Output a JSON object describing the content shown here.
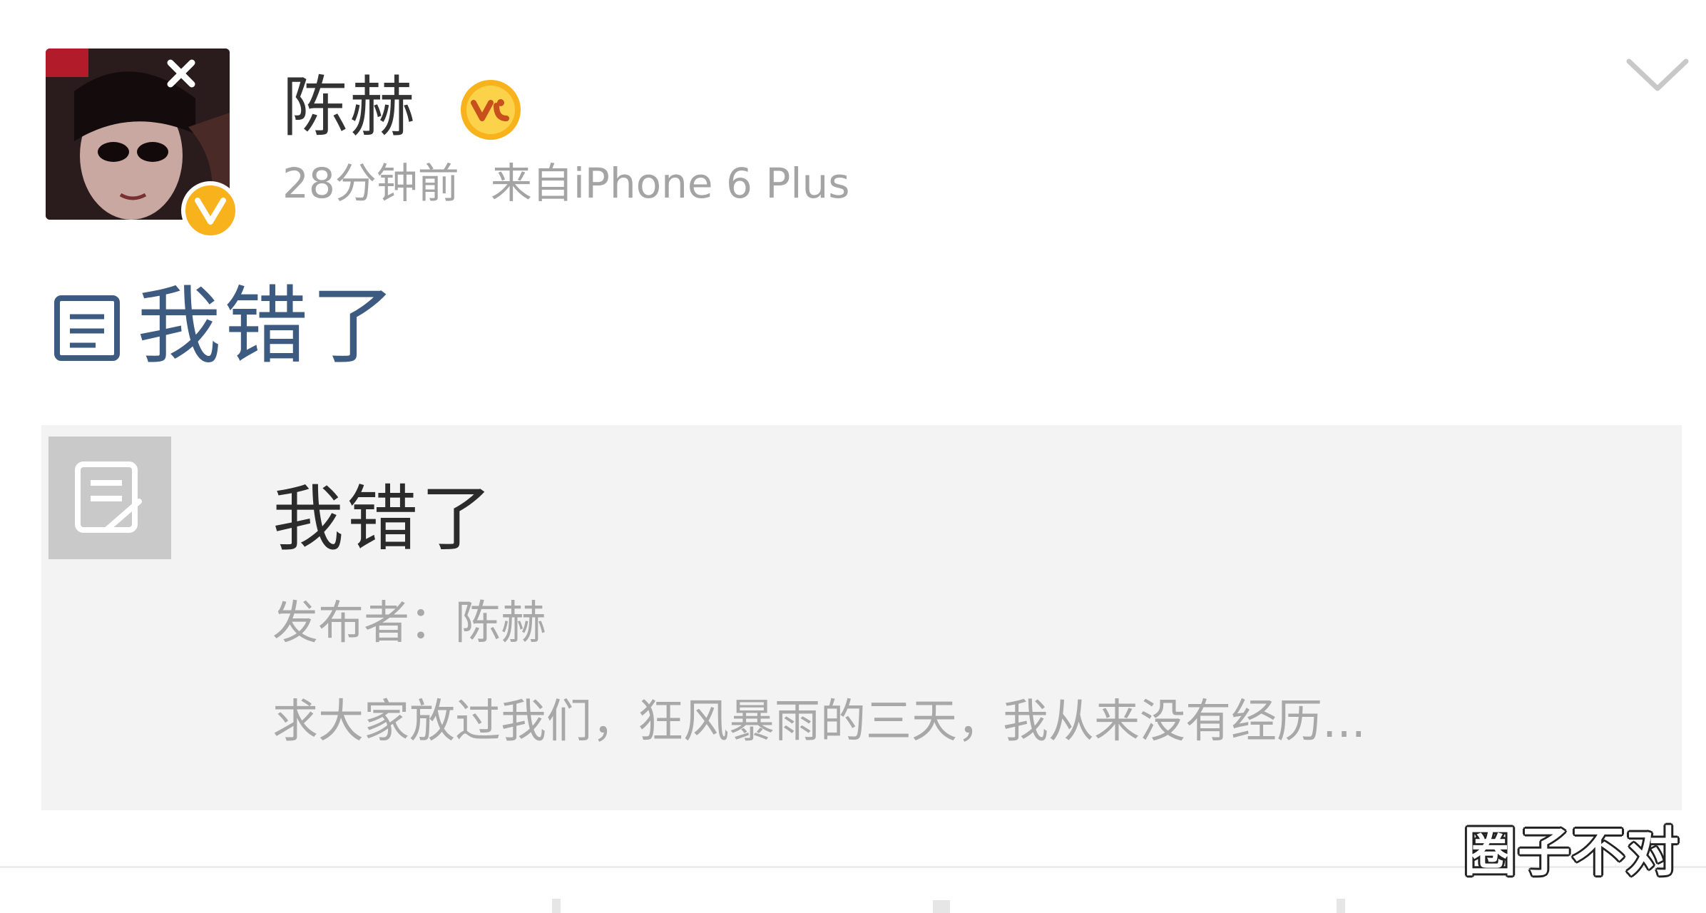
{
  "post": {
    "username": "陈赫",
    "time": "28分钟前",
    "source": "来自iPhone 6 Plus",
    "text": "我错了"
  },
  "card": {
    "title": "我错了",
    "author": "发布者：陈赫",
    "description": "求大家放过我们，狂风暴雨的三天，我从来没有经历..."
  },
  "watermark": "圈子不对",
  "colors": {
    "verified": "#f7b21c",
    "link": "#3d5a80",
    "card_bg": "#f3f3f3"
  },
  "icons": {
    "dropdown": "chevron-down-icon",
    "vip": "vip-crown-icon",
    "verified": "verified-v-icon",
    "article": "article-icon"
  }
}
